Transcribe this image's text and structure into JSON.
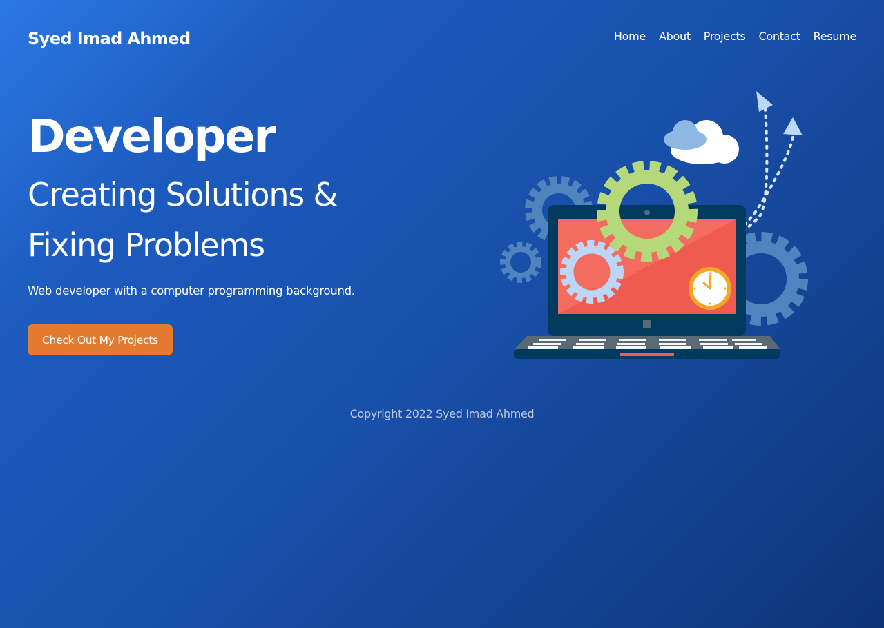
{
  "header": {
    "brand": "Syed Imad Ahmed",
    "nav": [
      {
        "label": "Home"
      },
      {
        "label": "About"
      },
      {
        "label": "Projects"
      },
      {
        "label": "Contact"
      },
      {
        "label": "Resume"
      }
    ]
  },
  "hero": {
    "title": "Developer",
    "subtitle": "Creating Solutions & Fixing Problems",
    "description": "Web developer with a computer programming background.",
    "cta_label": "Check Out My Projects",
    "illustration": {
      "icons": [
        "laptop-icon",
        "gear-icon",
        "cloud-icon",
        "clock-icon",
        "arrow-icon"
      ],
      "colors": {
        "gear_blue": "#4f84bf",
        "gear_green": "#b5d97a",
        "screen_red": "#ef5b4f",
        "laptop_body": "#003a5f",
        "clock_orange": "#f5a623",
        "cta": "#e47a30"
      }
    }
  },
  "footer": {
    "copyright": "Copyright 2022 Syed Imad Ahmed"
  }
}
